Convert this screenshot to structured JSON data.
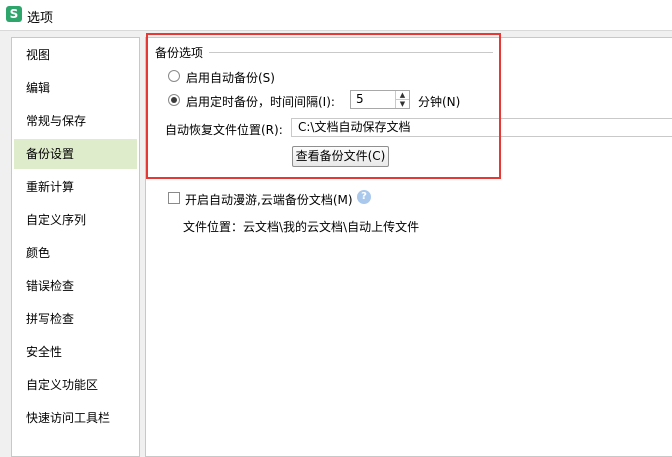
{
  "window": {
    "title": "选项",
    "icon": "wps-s-logo-icon"
  },
  "sidebar": {
    "items": [
      {
        "label": "视图"
      },
      {
        "label": "编辑"
      },
      {
        "label": "常规与保存"
      },
      {
        "label": "备份设置",
        "active": true
      },
      {
        "label": "重新计算"
      },
      {
        "label": "自定义序列"
      },
      {
        "label": "颜色"
      },
      {
        "label": "错误检查"
      },
      {
        "label": "拼写检查"
      },
      {
        "label": "安全性"
      },
      {
        "label": "自定义功能区"
      },
      {
        "label": "快速访问工具栏"
      }
    ]
  },
  "backup": {
    "group_title": "备份选项",
    "auto_backup_label": "启用自动备份(S)",
    "auto_backup_selected": false,
    "timed_backup_label": "启用定时备份，时间间隔(I):",
    "timed_backup_selected": true,
    "interval_value": "5",
    "interval_unit": "分钟(N)",
    "recover_location_label": "自动恢复文件位置(R):",
    "recover_location_value": "C:\\文档自动保存文档",
    "view_button_label": "查看备份文件(C)"
  },
  "roaming": {
    "checkbox_label": "开启自动漫游,云端备份文档(M)",
    "checked": false,
    "location_text": "文件位置：云文档\\我的云文档\\自动上传文件"
  },
  "colors": {
    "highlight": "#e53935",
    "active_item": "#dfeccb",
    "brand": "#2ea56b"
  }
}
